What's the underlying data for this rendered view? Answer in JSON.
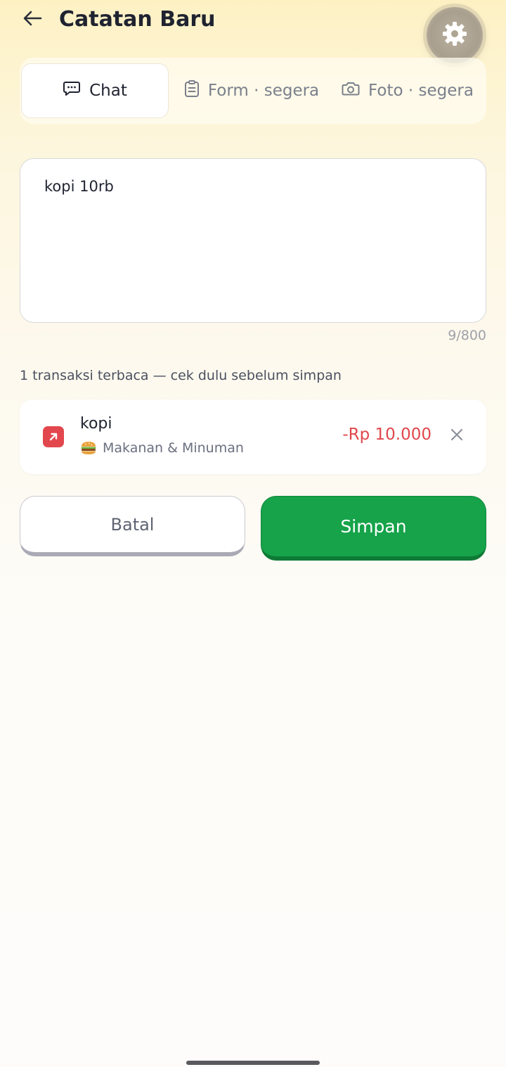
{
  "header": {
    "title": "Catatan Baru",
    "back_icon": "arrow-left-icon",
    "settings_icon": "gear-icon"
  },
  "mode_tabs": [
    {
      "label": "Chat",
      "icon": "chat-bubble-icon",
      "active": true
    },
    {
      "label": "Form · segera",
      "icon": "clipboard-icon",
      "active": false
    },
    {
      "label": "Foto · segera",
      "icon": "camera-icon",
      "active": false
    }
  ],
  "input": {
    "value": "kopi 10rb",
    "char_count": "9/800"
  },
  "parse_info": "1 transaksi terbaca — cek dulu sebelum simpan",
  "transactions": [
    {
      "name": "kopi",
      "category": "Makanan & Minuman",
      "category_icon": "burger-icon",
      "amount": "-Rp 10.000",
      "type_icon": "arrow-up-right-icon"
    }
  ],
  "actions": {
    "cancel_label": "Batal",
    "save_label": "Simpan"
  },
  "colors": {
    "expense_red": "#e0474c",
    "save_green": "#16a34a",
    "settings_bg": "#b3a998"
  }
}
